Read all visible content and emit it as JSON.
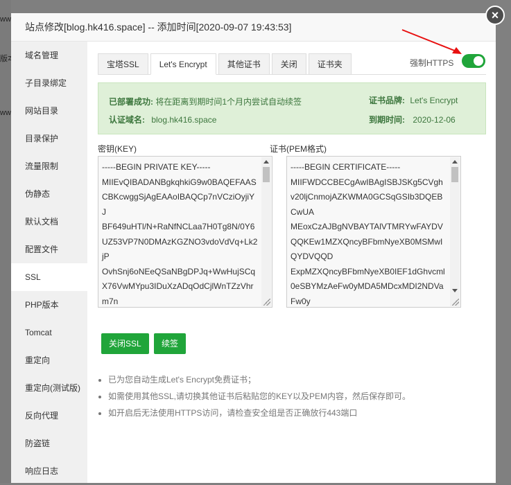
{
  "background": {
    "strips": [
      "ww.",
      "版本",
      "ww"
    ]
  },
  "dialog": {
    "title": "站点修改[blog.hk416.space] -- 添加时间[2020-09-07 19:43:53]",
    "close_glyph": "×"
  },
  "sidebar": {
    "items": [
      {
        "label": "域名管理"
      },
      {
        "label": "子目录绑定"
      },
      {
        "label": "网站目录"
      },
      {
        "label": "目录保护"
      },
      {
        "label": "流量限制"
      },
      {
        "label": "伪静态"
      },
      {
        "label": "默认文档"
      },
      {
        "label": "配置文件"
      },
      {
        "label": "SSL"
      },
      {
        "label": "PHP版本"
      },
      {
        "label": "Tomcat"
      },
      {
        "label": "重定向"
      },
      {
        "label": "重定向(测试版)"
      },
      {
        "label": "反向代理"
      },
      {
        "label": "防盗链"
      },
      {
        "label": "响应日志"
      }
    ],
    "active_index": 8
  },
  "tabs": [
    {
      "label": "宝塔SSL"
    },
    {
      "label": "Let's Encrypt"
    },
    {
      "label": "其他证书"
    },
    {
      "label": "关闭"
    },
    {
      "label": "证书夹"
    }
  ],
  "force_https": {
    "label": "强制HTTPS",
    "enabled": true
  },
  "notice": {
    "deployed_key": "已部署成功:",
    "deployed_value": "将在距离到期时间1个月内尝试自动续签",
    "domain_key": "认证域名:",
    "domain_value": "blog.hk416.space",
    "brand_key": "证书品牌:",
    "brand_value": "Let's Encrypt",
    "expiry_key": "到期时间:",
    "expiry_value": "2020-12-06"
  },
  "key_field": {
    "label": "密钥(KEY)",
    "value": "-----BEGIN PRIVATE KEY-----\nMIIEvQIBADANBgkqhkiG9w0BAQEFAASCBKcwggSjAgEAAoIBAQCp7nVCziOyjiYJ\nBF649uHTl/N+RaNfNCLaa7H0Tg8N/0Y6UZ53VP7N0DMAzKGZNO3vdoVdVq+Lk2jP\nOvhSnj6oNEeQSaNBgDPJq+WwHujSCqX76VwMYpu3IDuXzADqOdCjlWnTZzVhrm7n"
  },
  "cert_field": {
    "label": "证书(PEM格式)",
    "value": "-----BEGIN CERTIFICATE-----\nMIIFWDCCBECgAwIBAgISBJSKg5CVghv20ljCnmojAZKWMA0GCSqGSIb3DQEBCwUA\nMEoxCzAJBgNVBAYTAlVTMRYwFAYDVQQKEw1MZXQncyBFbmNyeXB0MSMwIQYDVQQD\nExpMZXQncyBFbmNyeXB0IEF1dGhvcml0eSBYMzAeFw0yMDA5MDcxMDI2NDVaFw0y"
  },
  "buttons": {
    "close_ssl": "关闭SSL",
    "renew": "续签"
  },
  "tips": [
    "已为您自动生成Let's Encrypt免费证书；",
    "如需使用其他SSL,请切换其他证书后粘贴您的KEY以及PEM内容，然后保存即可。",
    "如开启后无法使用HTTPS访问，请检查安全组是否正确放行443端口"
  ],
  "colors": {
    "accent": "#20a53a",
    "notice_bg": "#dff0d8",
    "notice_text": "#3c763d",
    "annotation_arrow": "#e81010"
  }
}
